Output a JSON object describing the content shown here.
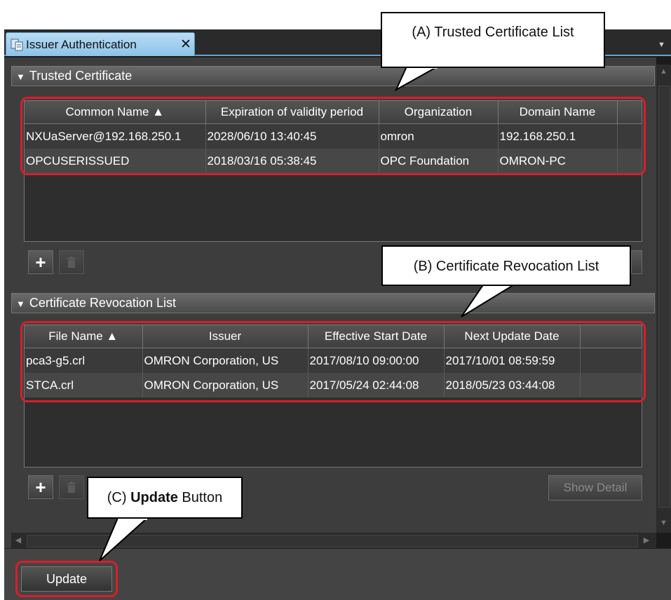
{
  "tab": {
    "title": "Issuer Authentication",
    "close_glyph": "✕",
    "icon": "certificate-icon"
  },
  "sections": {
    "trusted": {
      "title": "Trusted Certificate",
      "columns": [
        "Common Name ▲",
        "Expiration of validity period",
        "Organization",
        "Domain Name"
      ],
      "rows": [
        [
          "NXUaServer@192.168.250.1",
          "2028/06/10 13:40:45",
          "omron",
          "192.168.250.1"
        ],
        [
          "OPCUSERISSUED",
          "2018/03/16 05:38:45",
          "OPC Foundation",
          "OMRON-PC"
        ]
      ]
    },
    "revocation": {
      "title": "Certificate Revocation List",
      "columns": [
        "File Name ▲",
        "Issuer",
        "Effective Start Date",
        "Next Update Date"
      ],
      "rows": [
        [
          "pca3-g5.crl",
          "OMRON Corporation, US",
          "2017/08/10 09:00:00",
          "2017/10/01 08:59:59"
        ],
        [
          "STCA.crl",
          "OMRON Corporation, US",
          "2017/05/24 02:44:08",
          "2018/05/23 03:44:08"
        ]
      ]
    }
  },
  "buttons": {
    "add": "+",
    "delete_icon": "trash-icon",
    "show_detail": "Show Detail",
    "update": "Update"
  },
  "callouts": {
    "a": "(A) Trusted Certificate List",
    "b": "(B) Certificate Revocation List",
    "c_prefix": "(C) ",
    "c_bold": "Update",
    "c_suffix": " Button"
  },
  "colors": {
    "highlight": "#d81e2c",
    "tab_blue": "#8cc3e8"
  }
}
